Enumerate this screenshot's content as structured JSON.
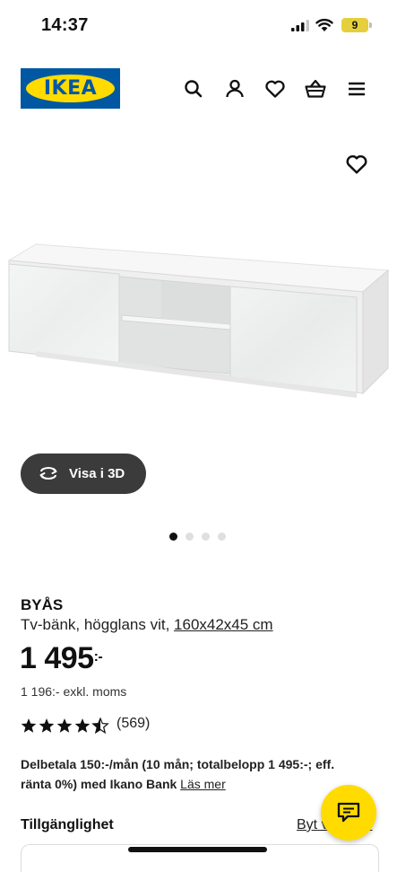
{
  "status_bar": {
    "time": "14:37",
    "battery": "9"
  },
  "header": {
    "logo_text": "IKEA",
    "icons": [
      "search-icon",
      "account-icon",
      "heart-icon",
      "cart-icon",
      "menu-icon"
    ]
  },
  "gallery": {
    "favourite_icon": "heart-icon",
    "view_3d_label": "Visa i 3D",
    "page_count": 4,
    "active_page": 1
  },
  "product": {
    "name": "BYÅS",
    "description": "Tv-bänk, högglans vit, ",
    "size": "160x42x45 cm",
    "price": "1 495",
    "price_suffix": ":-",
    "price_excl": "1 196:- exkl. moms",
    "rating": 4.5,
    "rating_max": 5,
    "review_count": "(569)",
    "installment_text": "Delbetala 150:-/mån (10 mån; totalbelopp 1 495:-; eff. ränta 0%) med Ikano Bank ",
    "installment_link": "Läs mer"
  },
  "availability": {
    "title": "Tillgänglighet",
    "change_link": "Byt varuhus"
  },
  "chat": {
    "icon": "chat-icon"
  },
  "colors": {
    "ikea_blue": "#0058a3",
    "ikea_yellow": "#ffdb00",
    "button_dark": "#3b3b3b"
  }
}
